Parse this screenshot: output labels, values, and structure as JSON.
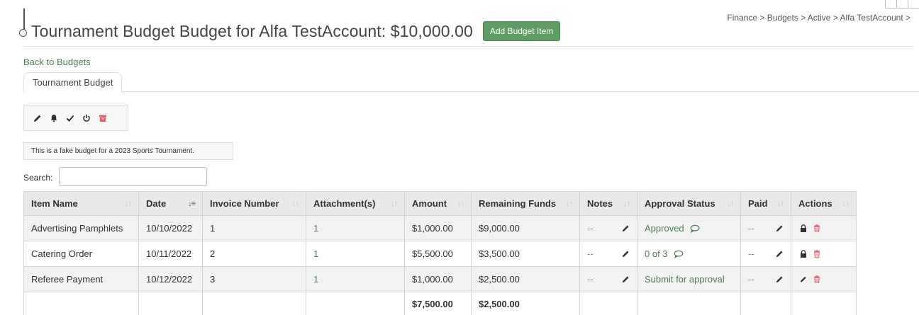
{
  "page": {
    "title": "Tournament Budget Budget for Alfa TestAccount: $10,000.00",
    "add_button_label": "Add Budget Item",
    "breadcrumb": "Finance > Budgets > Active > Alfa TestAccount >",
    "back_link": "Back to Budgets",
    "tab_label": "Tournament Budget",
    "description": "This is a fake budget for a 2023 Sports Tournament.",
    "search_label": "Search:",
    "search_value": ""
  },
  "toolbar_icons": [
    "edit-icon",
    "bell-icon",
    "check-icon",
    "power-icon",
    "archive-icon"
  ],
  "colors": {
    "accent_green": "#5f9d65",
    "link_green": "#4f7f52",
    "danger_red": "#e4606d",
    "header_bg": "#e9e9e9"
  },
  "table": {
    "headers": [
      "Item Name",
      "Date",
      "Invoice Number",
      "Attachment(s)",
      "Amount",
      "Remaining Funds",
      "Notes",
      "Approval Status",
      "Paid",
      "Actions"
    ],
    "sorted_column": "Date",
    "rows": [
      {
        "item_name": "Advertising Pamphlets",
        "date": "10/10/2022",
        "invoice": "1",
        "attachments": "1",
        "amount": "$1,000.00",
        "remaining": "$9,000.00",
        "notes": "--",
        "approval": "Approved",
        "paid": "--",
        "locked": true
      },
      {
        "item_name": "Catering Order",
        "date": "10/11/2022",
        "invoice": "2",
        "attachments": "1",
        "amount": "$5,500.00",
        "remaining": "$3,500.00",
        "notes": "--",
        "approval": "0 of 3",
        "paid": "--",
        "locked": true
      },
      {
        "item_name": "Referee Payment",
        "date": "10/12/2022",
        "invoice": "3",
        "attachments": "1",
        "amount": "$1,000.00",
        "remaining": "$2,500.00",
        "notes": "--",
        "approval": "Submit for approval",
        "paid": "--",
        "locked": false
      }
    ],
    "totals": {
      "amount": "$7,500.00",
      "remaining": "$2,500.00"
    }
  }
}
